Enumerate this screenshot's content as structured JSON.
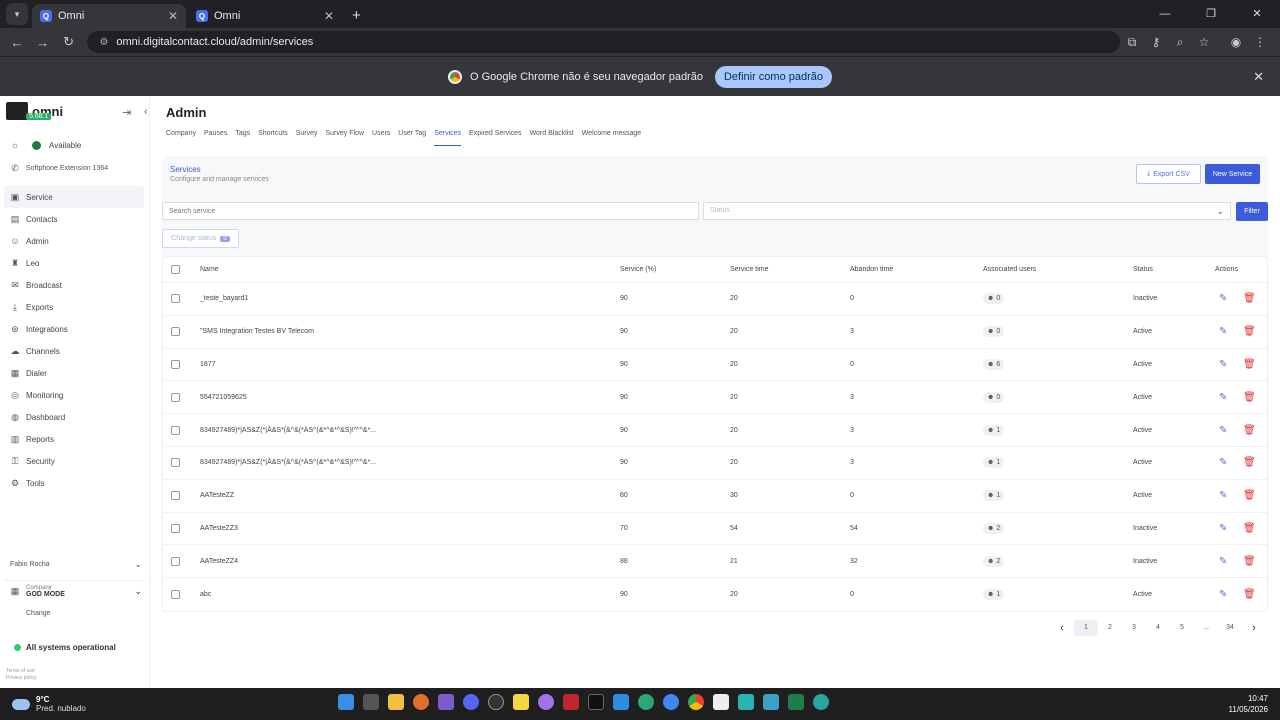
{
  "browser": {
    "tabs": [
      {
        "title": "Omni",
        "favicon": "Q"
      },
      {
        "title": "Omni",
        "favicon": "Q"
      }
    ],
    "url": "omni.digitalcontact.cloud/admin/services",
    "infobar_text": "O Google Chrome não é seu navegador padrão",
    "infobar_button": "Definir como padrão"
  },
  "sidebar": {
    "brand": "omni",
    "version": "5.68.1",
    "availability": "Available",
    "softphone": "Softphone Extension 1364",
    "items": [
      {
        "label": "Service",
        "icon": "bookmark-icon",
        "active": true
      },
      {
        "label": "Contacts",
        "icon": "contacts-icon"
      },
      {
        "label": "Admin",
        "icon": "user-icon"
      },
      {
        "label": "Leo",
        "icon": "leo-icon"
      },
      {
        "label": "Broadcast",
        "icon": "broadcast-icon"
      },
      {
        "label": "Exports",
        "icon": "download-icon"
      },
      {
        "label": "Integrations",
        "icon": "integrations-icon"
      },
      {
        "label": "Channels",
        "icon": "channels-icon"
      },
      {
        "label": "Dialer",
        "icon": "dialer-icon"
      },
      {
        "label": "Monitoring",
        "icon": "monitoring-icon"
      },
      {
        "label": "Dashboard",
        "icon": "dashboard-icon"
      },
      {
        "label": "Reports",
        "icon": "reports-icon"
      },
      {
        "label": "Security",
        "icon": "key-icon"
      },
      {
        "label": "Tools",
        "icon": "gear-icon"
      }
    ],
    "user": "Fabio Rocha",
    "company_label": "Company",
    "company_value": "GOD MODE",
    "change": "Change",
    "system_status": "All systems operational",
    "terms": "Terms of use",
    "privacy": "Privacy policy"
  },
  "main": {
    "title": "Admin",
    "subnav": [
      "Company",
      "Pauses",
      "Tags",
      "Shortcuts",
      "Survey",
      "Survey Flow",
      "Users",
      "User Tag",
      "Services",
      "Expired Services",
      "Word Blacklist",
      "Welcome message"
    ],
    "active_subnav": "Services",
    "card_title": "Services",
    "card_subtitle": "Configure and manage services",
    "export_label": "Export CSV",
    "new_label": "New Service",
    "search_placeholder": "Search service",
    "status_placeholder": "Status",
    "filter_label": "Filter",
    "change_status_label": "Change status",
    "change_status_count": "0",
    "columns": [
      "Name",
      "Service (%)",
      "Service time",
      "Abandon time",
      "Associated users",
      "Status",
      "Actions"
    ],
    "rows": [
      {
        "name": "_teste_bayard1",
        "svc": "90",
        "time": "20",
        "ab": "0",
        "users": "0",
        "status": "Inactive"
      },
      {
        "name": "\"SMS Integration Testes BV Telecom",
        "svc": "90",
        "time": "20",
        "ab": "3",
        "users": "0",
        "status": "Active"
      },
      {
        "name": "1877",
        "svc": "90",
        "time": "20",
        "ab": "0",
        "users": "6",
        "status": "Active"
      },
      {
        "name": "554721059625",
        "svc": "90",
        "time": "20",
        "ab": "3",
        "users": "0",
        "status": "Active"
      },
      {
        "name": "834927489)*|AS&Z(*|Å&S*(&^&(*AS^(&*^&*^&S)!^\"^&*...",
        "svc": "90",
        "time": "20",
        "ab": "3",
        "users": "1",
        "status": "Active"
      },
      {
        "name": "834927489)*|AS&Z(*|Å&S*(&^&(*AS^(&*^&*^&S)!^\"^&*...",
        "svc": "90",
        "time": "20",
        "ab": "3",
        "users": "1",
        "status": "Active"
      },
      {
        "name": "AATesteZZ",
        "svc": "80",
        "time": "30",
        "ab": "0",
        "users": "1",
        "status": "Active"
      },
      {
        "name": "AATesteZZ3",
        "svc": "70",
        "time": "54",
        "ab": "54",
        "users": "2",
        "status": "Inactive"
      },
      {
        "name": "AATesteZZ4",
        "svc": "88",
        "time": "21",
        "ab": "32",
        "users": "2",
        "status": "Inactive"
      },
      {
        "name": "abc",
        "svc": "90",
        "time": "20",
        "ab": "0",
        "users": "1",
        "status": "Active"
      }
    ],
    "pagination": [
      "1",
      "2",
      "3",
      "4",
      "5",
      "...",
      "34"
    ]
  },
  "taskbar": {
    "temp": "9°C",
    "condition": "Pred. nublado",
    "time": "10:47",
    "date": "11/05/2026"
  },
  "colors": {
    "accent": "#3b5bdb",
    "danger": "#e03131",
    "success": "#1a7f37"
  }
}
